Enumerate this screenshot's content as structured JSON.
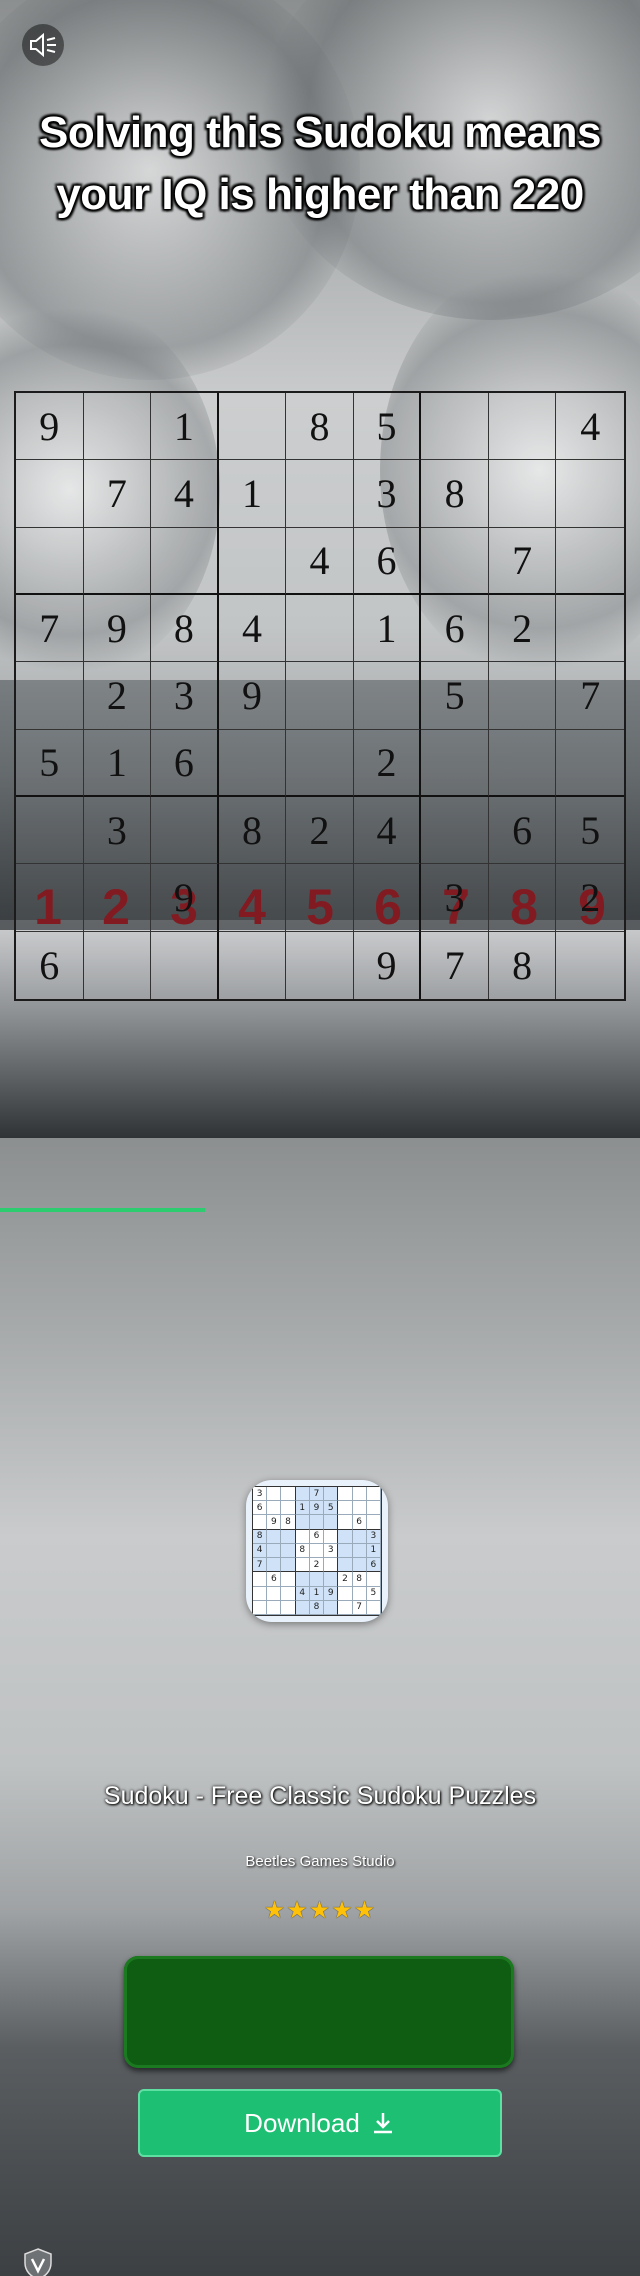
{
  "headline": {
    "line1": "Solving this Sudoku means",
    "line2": "your IQ is higher than 220"
  },
  "grid": {
    "rows": [
      [
        "9",
        "",
        "1",
        "",
        "8",
        "5",
        "",
        "",
        "4"
      ],
      [
        "",
        "7",
        "4",
        "1",
        "",
        "3",
        "8",
        "",
        ""
      ],
      [
        "",
        "",
        "",
        "",
        "4",
        "6",
        "",
        "7",
        ""
      ],
      [
        "7",
        "9",
        "8",
        "4",
        "",
        "1",
        "6",
        "2",
        ""
      ],
      [
        "",
        "2",
        "3",
        "9",
        "",
        "",
        "5",
        "",
        "7"
      ],
      [
        "5",
        "1",
        "6",
        "",
        "",
        "2",
        "",
        "",
        ""
      ],
      [
        "",
        "3",
        "",
        "8",
        "2",
        "4",
        "",
        "6",
        "5"
      ],
      [
        "",
        "",
        "9",
        "",
        "",
        "",
        "3",
        "",
        "2"
      ],
      [
        "6",
        "",
        "",
        "",
        "",
        "9",
        "7",
        "8",
        ""
      ]
    ]
  },
  "app_icon": {
    "rows": [
      [
        "3",
        "",
        "",
        "",
        "7",
        "",
        "",
        "",
        ""
      ],
      [
        "6",
        "",
        "",
        "1",
        "9",
        "5",
        "",
        "",
        ""
      ],
      [
        "",
        "9",
        "8",
        "",
        "",
        "",
        "",
        "6",
        ""
      ],
      [
        "8",
        "",
        "",
        "",
        "6",
        "",
        "",
        "",
        "3"
      ],
      [
        "4",
        "",
        "",
        "8",
        "",
        "3",
        "",
        "",
        "1"
      ],
      [
        "7",
        "",
        "",
        "",
        "2",
        "",
        "",
        "",
        "6"
      ],
      [
        "",
        "6",
        "",
        "",
        "",
        "",
        "2",
        "8",
        ""
      ],
      [
        "",
        "",
        "",
        "4",
        "1",
        "9",
        "",
        "",
        "5"
      ],
      [
        "",
        "",
        "",
        "",
        "8",
        "",
        "",
        "7",
        ""
      ]
    ]
  },
  "number_bar": [
    "1",
    "2",
    "3",
    "4",
    "5",
    "6",
    "7",
    "8",
    "9"
  ],
  "app": {
    "name": "Sudoku - Free Classic Sudoku Puzzles",
    "studio": "Beetles Games Studio",
    "rating_stars": "★★★★★",
    "rating": 5
  },
  "download_button": {
    "label": "Download"
  },
  "colors": {
    "download_green": "#1dbf73",
    "frame_green": "#0f5d12",
    "number_red": "#7b0d14",
    "star_yellow": "#ffc107"
  },
  "icons": [
    "speaker-icon",
    "download-icon",
    "shield-v-icon"
  ]
}
